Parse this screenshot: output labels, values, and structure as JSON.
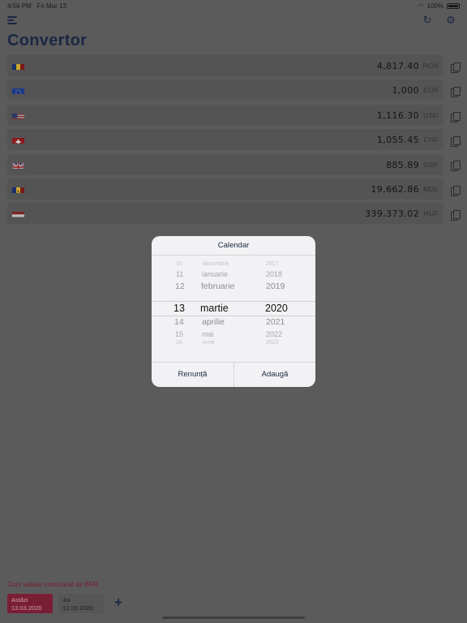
{
  "status": {
    "time": "4:56 PM",
    "date": "Fri Mar 13",
    "battery": "100%"
  },
  "header": {
    "title": "Convertor"
  },
  "currencies": [
    {
      "amount": "4,817.40",
      "code": "RON",
      "flag": "ro"
    },
    {
      "amount": "1,000",
      "code": "EUR",
      "flag": "eu"
    },
    {
      "amount": "1,116.30",
      "code": "USD",
      "flag": "us"
    },
    {
      "amount": "1,055.45",
      "code": "CHF",
      "flag": "ch"
    },
    {
      "amount": "885.89",
      "code": "GBP",
      "flag": "gb"
    },
    {
      "amount": "19,662.86",
      "code": "MDL",
      "flag": "md"
    },
    {
      "amount": "339,373.02",
      "code": "HUF",
      "flag": "hu"
    }
  ],
  "footer": {
    "label": "Curs valutar comunicat de BNR",
    "chips": [
      {
        "day": "Astăzi",
        "date": "13.03.2020"
      },
      {
        "day": "Joi",
        "date": "12.03.2020"
      }
    ],
    "add_symbol": "+"
  },
  "dialog": {
    "title": "Calendar",
    "cancel_label": "Renunță",
    "confirm_label": "Adaugă",
    "days": [
      "10",
      "11",
      "12",
      "13",
      "14",
      "15",
      "16"
    ],
    "months": [
      "decembrie",
      "ianuarie",
      "februarie",
      "martie",
      "aprilie",
      "mai",
      "iunie"
    ],
    "years": [
      "2017",
      "2018",
      "2019",
      "2020",
      "2021",
      "2022",
      "2023"
    ],
    "selected": {
      "day": "13",
      "month": "martie",
      "year": "2020"
    }
  },
  "colors": {
    "overlay_bg": "#5b5b5b",
    "title_navy": "#1b2744",
    "accent_red": "#7a1e35"
  }
}
